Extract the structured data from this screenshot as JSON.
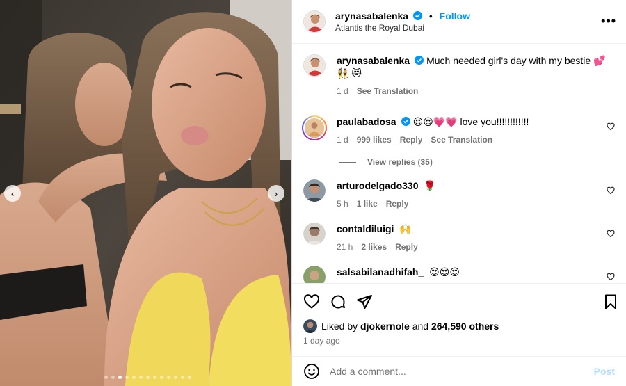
{
  "post": {
    "author": "arynasabalenka",
    "location": "Atlantis the Royal Dubai",
    "follow_label": "Follow",
    "more_label": "•••"
  },
  "caption": {
    "username": "arynasabalenka",
    "text": "Much needed girl's day with my bestie 💕 👯‍♀️ 😻",
    "time": "1 d",
    "translate": "See Translation"
  },
  "comments": [
    {
      "username": "paulabadosa",
      "verified": true,
      "text": "😍😍💗💗 love you!!!!!!!!!!!!",
      "time": "1 d",
      "likes": "999 likes",
      "reply": "Reply",
      "translate": "See Translation",
      "view_replies": "View replies (35)"
    },
    {
      "username": "arturodelgado330",
      "text": "🌹",
      "time": "5 h",
      "likes": "1 like",
      "reply": "Reply"
    },
    {
      "username": "contaldiluigi",
      "text": "🙌",
      "time": "21 h",
      "likes": "2 likes",
      "reply": "Reply"
    },
    {
      "username": "salsabilanadhifah_",
      "text": "😍😍😍",
      "time": "",
      "likes": "",
      "reply": ""
    }
  ],
  "likes": {
    "prefix": "Liked by",
    "user": "djokernole",
    "and": "and",
    "count": "264,590 others"
  },
  "time_ago": "1 day ago",
  "add_comment": {
    "placeholder": "Add a comment...",
    "post_label": "Post"
  },
  "carousel": {
    "prev": "‹",
    "next": "›",
    "total_slides": 13,
    "active_index": 2
  },
  "colors": {
    "link": "#0095f6",
    "verified": "#0095f6",
    "post_disabled": "#b2dffc",
    "muted": "#737373"
  }
}
